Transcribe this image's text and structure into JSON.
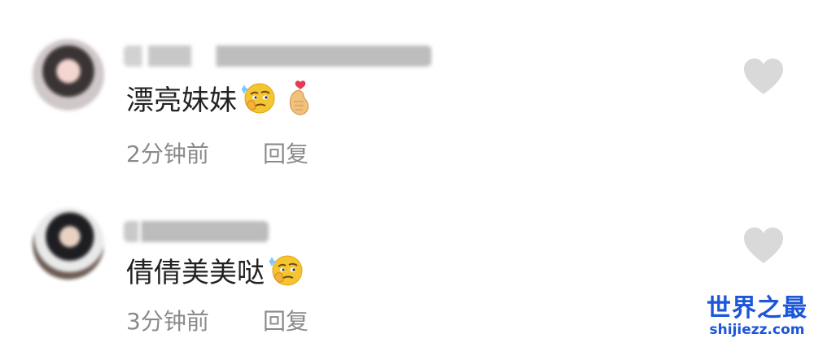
{
  "comments": [
    {
      "username": "",
      "text": "漂亮妹妹",
      "emojis": [
        "thinking-face-emoji",
        "finger-heart-emoji"
      ],
      "time": "2分钟前",
      "reply_label": "回复",
      "like_icon": "heart-icon"
    },
    {
      "username": "",
      "text": "倩倩美美哒",
      "emojis": [
        "thinking-face-emoji"
      ],
      "time": "3分钟前",
      "reply_label": "回复",
      "like_icon": "heart-icon"
    }
  ],
  "watermark": {
    "line1": "世界之最",
    "line2": "shijiezz.com"
  },
  "colors": {
    "text": "#222222",
    "meta": "#8a8a8a",
    "heart": "#d9d9d9",
    "watermark": "#1c56d9"
  }
}
